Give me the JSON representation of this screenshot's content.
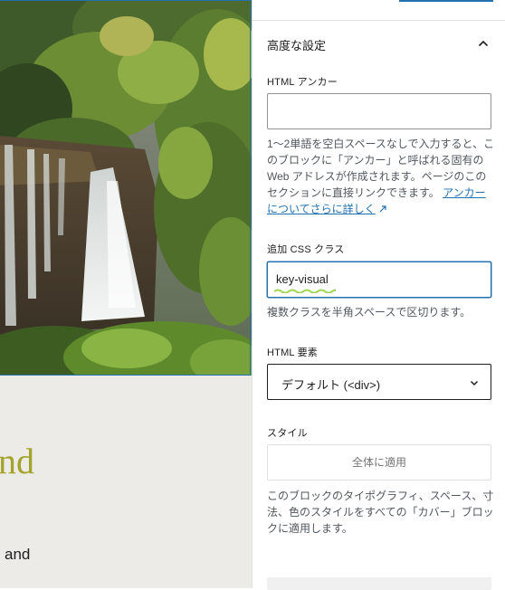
{
  "canvas": {
    "heading_fragment": "nd",
    "text_fragment": "and"
  },
  "sidebar": {
    "panel_title": "高度な設定",
    "html_anchor": {
      "label": "HTML アンカー",
      "value": "",
      "help_text": "1〜2単語を空白スペースなしで入力すると、このブロックに「アンカー」と呼ばれる固有の Web アドレスが作成されます。ページのこのセクションに直接リンクできます。",
      "help_link": "アンカーについてさらに詳しく"
    },
    "css_class": {
      "label": "追加 CSS クラス",
      "value": "key-visual",
      "help_text": "複数クラスを半角スペースで区切ります。"
    },
    "html_element": {
      "label": "HTML 要素",
      "selected": "デフォルト (<div>)"
    },
    "style": {
      "label": "スタイル",
      "button_label": "全体に適用",
      "help_text": "このブロックのタイポグラフィ、スペース、寸法、色のスタイルをすべての「カバー」ブロックに適用します。"
    }
  },
  "colors": {
    "accent": "#2271b1",
    "canvas_background": "#ecebe8",
    "heading_color": "#a3a32a"
  }
}
